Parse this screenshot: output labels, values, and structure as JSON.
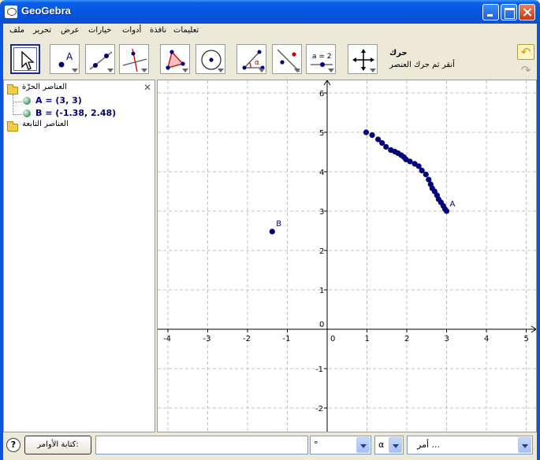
{
  "window": {
    "title": "GeoGebra"
  },
  "menu": [
    "ملف",
    "تحرير",
    "عرض",
    "خيارات",
    "أدوات",
    "نافذة",
    "تعليمات"
  ],
  "toolbar": {
    "tools": [
      {
        "name": "move-tool",
        "icon": "arrow-cursor-icon",
        "selected": true
      },
      {
        "name": "point-tool",
        "icon": "point-icon"
      },
      {
        "name": "line-tool",
        "icon": "line-through-two-points-icon"
      },
      {
        "name": "perpendicular-tool",
        "icon": "perpendicular-line-icon"
      },
      {
        "name": "polygon-tool",
        "icon": "polygon-icon"
      },
      {
        "name": "circle-tool",
        "icon": "circle-center-point-icon"
      },
      {
        "name": "angle-tool",
        "icon": "angle-icon"
      },
      {
        "name": "reflect-tool",
        "icon": "reflect-point-icon"
      },
      {
        "name": "slider-tool",
        "icon": "slider-icon"
      },
      {
        "name": "move-view-tool",
        "icon": "move-graphics-view-icon"
      }
    ],
    "slider_label": "a = 2",
    "angle_label": "α",
    "help_title": "حرك",
    "help_desc": "أنقر ثم حرك العنصر"
  },
  "algebra": {
    "free_header": "العناصر الحرّة",
    "dependent_header": "العناصر التابعة",
    "objects": [
      "A = (3, 3)",
      "B = (-1.38, 2.48)"
    ]
  },
  "graphics": {
    "x_range": [
      -4.3,
      5.1
    ],
    "y_range": [
      -2.6,
      6.1
    ],
    "x_ticks": [
      -4,
      -3,
      -2,
      -1,
      0,
      1,
      2,
      3,
      4,
      5
    ],
    "y_ticks": [
      -2,
      -1,
      0,
      1,
      2,
      3,
      4,
      5,
      6
    ],
    "grid": true,
    "point_A": {
      "label": "A",
      "x": 3,
      "y": 3
    },
    "point_B": {
      "label": "B",
      "x": -1.38,
      "y": 2.48
    },
    "trace_points": [
      [
        0.98,
        5.0
      ],
      [
        1.13,
        4.93
      ],
      [
        1.28,
        4.82
      ],
      [
        1.38,
        4.73
      ],
      [
        1.48,
        4.63
      ],
      [
        1.6,
        4.55
      ],
      [
        1.7,
        4.51
      ],
      [
        1.78,
        4.47
      ],
      [
        1.86,
        4.42
      ],
      [
        1.93,
        4.37
      ],
      [
        1.98,
        4.31
      ],
      [
        2.08,
        4.26
      ],
      [
        2.2,
        4.2
      ],
      [
        2.3,
        4.14
      ],
      [
        2.38,
        4.03
      ],
      [
        2.48,
        3.93
      ],
      [
        2.55,
        3.8
      ],
      [
        2.6,
        3.68
      ],
      [
        2.64,
        3.58
      ],
      [
        2.7,
        3.5
      ],
      [
        2.76,
        3.4
      ],
      [
        2.8,
        3.3
      ],
      [
        2.86,
        3.22
      ],
      [
        2.92,
        3.13
      ],
      [
        2.96,
        3.05
      ]
    ],
    "colors": {
      "point": "#00007f",
      "grid": "#c0c0c0"
    }
  },
  "input": {
    "command_button": "كتابة الأوامر:",
    "command_value": "",
    "symbol_select": "°",
    "greek_select": "α",
    "commands_select": "أمر ..."
  }
}
